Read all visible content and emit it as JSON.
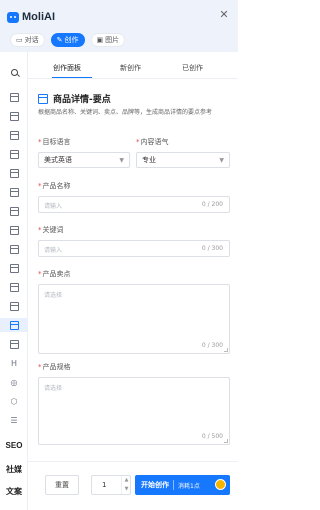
{
  "app": {
    "name": "MoliAI",
    "close_icon": "close-icon"
  },
  "mode_tabs": [
    {
      "label": "对话",
      "icon": "chat-icon"
    },
    {
      "label": "创作",
      "icon": "edit-icon",
      "active": true
    },
    {
      "label": "图片",
      "icon": "image-icon"
    }
  ],
  "sidebar": {
    "text_items": [
      "SEO",
      "社媒",
      "文案"
    ]
  },
  "tabs": [
    "创作面板",
    "新创作",
    "已创作"
  ],
  "panel": {
    "title": "商品详情-要点",
    "description": "根据商品名称、关键词、卖点、品牌等，生成商品详情的要点参考"
  },
  "form": {
    "target_language": {
      "label": "目标语言",
      "value": "美式英语"
    },
    "tone": {
      "label": "内容语气",
      "value": "专业"
    },
    "product_name": {
      "label": "产品名称",
      "placeholder": "请输入",
      "count": "0 / 200"
    },
    "keywords": {
      "label": "关键词",
      "placeholder": "请输入",
      "count": "0 / 300"
    },
    "selling_points": {
      "label": "产品卖点",
      "placeholder": "请选择",
      "count": "0 / 300"
    },
    "specs": {
      "label": "产品规格",
      "placeholder": "请选择",
      "count": "0 / 500"
    }
  },
  "footer": {
    "reset_label": "重置",
    "quantity": "1",
    "start_label": "开始创作",
    "cost_label": "消耗1点"
  },
  "colors": {
    "accent": "#1677ff",
    "required": "#e5484d",
    "coin": "#f7b500"
  }
}
